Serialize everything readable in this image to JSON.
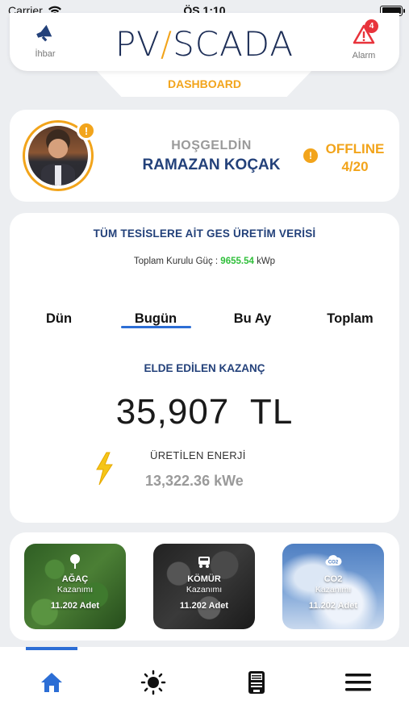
{
  "status_bar": {
    "carrier": "Carrier",
    "time": "ÖS 1:10"
  },
  "header": {
    "logo_pv": "PV",
    "logo_scada": "SCADA",
    "report_label": "İhbar",
    "alarm_label": "Alarm",
    "alarm_count": "4",
    "section_label": "DASHBOARD"
  },
  "profile": {
    "greeting": "HOŞGELDİN",
    "name": "RAMAZAN KOÇAK",
    "avatar_badge": "!",
    "status_icon": "!",
    "status_label": "OFFLINE",
    "status_count": "4/20"
  },
  "production": {
    "title": "TÜM TESİSLERE AİT GES ÜRETİM VERİSİ",
    "installed_label": "Toplam Kurulu Güç :",
    "installed_value": "9655.54",
    "installed_unit": "kWp",
    "tabs": [
      "Dün",
      "Bugün",
      "Bu Ay",
      "Toplam"
    ],
    "active_tab": "Bugün",
    "earnings_title": "ELDE EDİLEN KAZANÇ",
    "earnings_value": "35,907  TL",
    "energy_label": "ÜRETİLEN ENERJİ",
    "energy_value": "13,322.36 kWe"
  },
  "impact": [
    {
      "name": "AĞAÇ",
      "sub": "Kazanımı",
      "value": "11.202 Adet",
      "icon": "tree-icon"
    },
    {
      "name": "KÖMÜR",
      "sub": "Kazanımı",
      "value": "11.202 Adet",
      "icon": "coal-cart-icon"
    },
    {
      "name": "CO2",
      "sub": "Kazanımı",
      "value": "11.202 Adet",
      "icon": "co2-cloud-icon"
    }
  ],
  "bottom_nav": {
    "items": [
      "home-icon",
      "sun-icon",
      "meter-icon",
      "menu-icon"
    ],
    "active": "home-icon"
  },
  "colors": {
    "accent": "#f2a41b",
    "brand_navy": "#23417a",
    "active_blue": "#2c6ed5",
    "installed_green": "#2fbf3a",
    "alarm_red": "#e8333b"
  }
}
